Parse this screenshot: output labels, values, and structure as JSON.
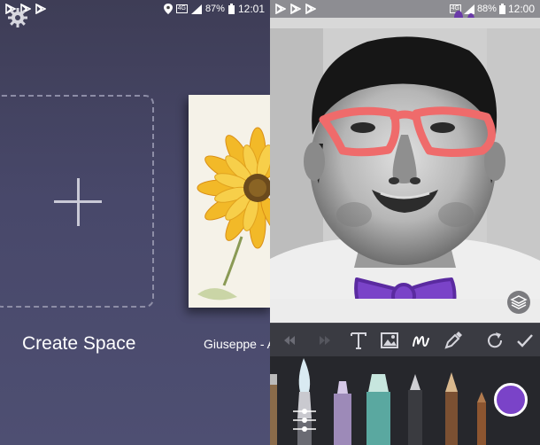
{
  "left_screen": {
    "status_bar": {
      "notification_icons": [
        "play-store-icon",
        "play-store-icon",
        "play-store-icon"
      ],
      "location_icon": "location-icon",
      "network": "4G",
      "battery": "87%",
      "time": "12:01"
    },
    "settings_icon": "gear-icon",
    "create_space": {
      "label": "Create Space",
      "icon": "plus-icon"
    },
    "space_thumbnail": {
      "label": "Giuseppe - A"
    }
  },
  "right_screen": {
    "status_bar": {
      "notification_icons": [
        "play-store-icon",
        "play-store-icon",
        "play-store-icon"
      ],
      "network": "4G",
      "battery": "88%",
      "time": "12:00"
    },
    "layers_icon": "layers-icon",
    "toolbar": [
      "undo-icon",
      "redo-icon",
      "text-icon",
      "image-icon",
      "brush-icon",
      "eyedropper-icon",
      "rotate-icon",
      "check-icon"
    ],
    "brush_tools": [
      "paint-brush",
      "marker",
      "highlighter",
      "fountain-pen",
      "pencil",
      "crayon"
    ],
    "current_color": "#7a43c8"
  }
}
